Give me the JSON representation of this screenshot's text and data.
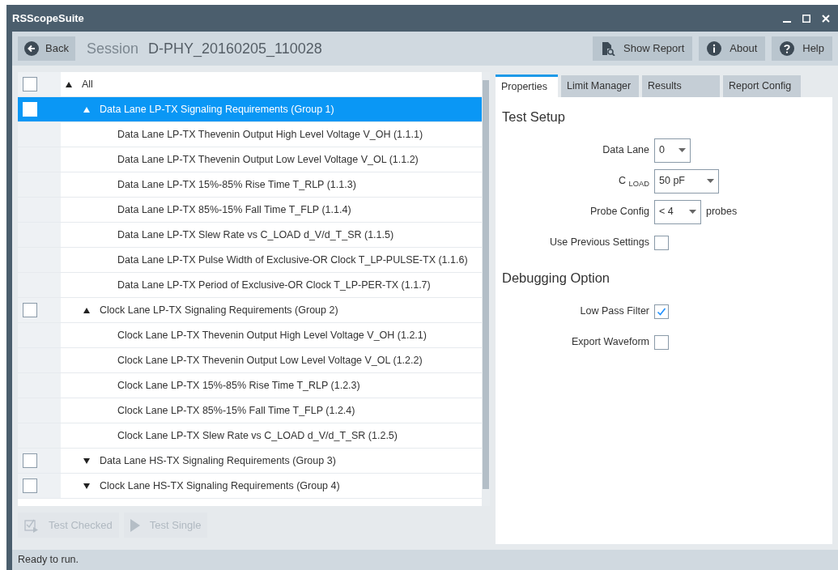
{
  "window": {
    "title": "RSScopeSuite"
  },
  "toolbar": {
    "back": "Back",
    "session_label": "Session",
    "session_name": "D-PHY_20160205_110028",
    "buttons": [
      {
        "kind": "report",
        "label": "Show Report"
      },
      {
        "kind": "about",
        "label": "About"
      },
      {
        "kind": "help",
        "label": "Help"
      }
    ]
  },
  "tree": [
    {
      "label": "All",
      "checked": false,
      "expanded": true,
      "selected": false,
      "children": [
        {
          "label": "Data Lane LP-TX Signaling Requirements (Group 1)",
          "checked": false,
          "expanded": true,
          "selected": true,
          "children": [
            {
              "label": "Data Lane LP-TX Thevenin Output High Level Voltage V_OH (1.1.1)",
              "selected": false
            },
            {
              "label": "Data Lane LP-TX Thevenin Output Low Level Voltage V_OL (1.1.2)",
              "selected": false
            },
            {
              "label": "Data Lane LP-TX 15%-85% Rise Time T_RLP (1.1.3)",
              "selected": false
            },
            {
              "label": "Data Lane LP-TX 85%-15% Fall Time T_FLP (1.1.4)",
              "selected": false
            },
            {
              "label": "Data Lane LP-TX Slew Rate vs C_LOAD d_V/d_T_SR (1.1.5)",
              "selected": false
            },
            {
              "label": "Data Lane LP-TX Pulse Width of Exclusive-OR Clock T_LP-PULSE-TX (1.1.6)",
              "selected": false
            },
            {
              "label": "Data Lane LP-TX Period of Exclusive-OR Clock T_LP-PER-TX (1.1.7)",
              "selected": false
            }
          ]
        },
        {
          "label": "Clock Lane LP-TX Signaling Requirements (Group 2)",
          "checked": false,
          "expanded": true,
          "selected": false,
          "children": [
            {
              "label": "Clock Lane LP-TX Thevenin Output High Level Voltage V_OH (1.2.1)",
              "selected": false
            },
            {
              "label": "Clock Lane LP-TX Thevenin Output Low Level Voltage V_OL (1.2.2)",
              "selected": false
            },
            {
              "label": "Clock Lane LP-TX 15%-85% Rise Time T_RLP (1.2.3)",
              "selected": false
            },
            {
              "label": "Clock Lane LP-TX 85%-15% Fall Time T_FLP (1.2.4)",
              "selected": false
            },
            {
              "label": "Clock Lane LP-TX Slew Rate vs C_LOAD d_V/d_T_SR (1.2.5)",
              "selected": false
            }
          ]
        },
        {
          "label": "Data Lane HS-TX Signaling Requirements (Group 3)",
          "checked": false,
          "expanded": false,
          "selected": false
        },
        {
          "label": "Clock Lane HS-TX Signaling Requirements (Group 4)",
          "checked": false,
          "expanded": false,
          "selected": false
        }
      ]
    }
  ],
  "actions": [
    {
      "kind": "checked",
      "label": "Test Checked",
      "disabled": true
    },
    {
      "kind": "single",
      "label": "Test Single",
      "disabled": true
    }
  ],
  "tabs": [
    {
      "label": "Properties",
      "selected": true
    },
    {
      "label": "Limit Manager",
      "selected": false
    },
    {
      "label": "Results",
      "selected": false
    },
    {
      "label": "Report Config",
      "selected": false
    }
  ],
  "sections": [
    {
      "title": "Test Setup",
      "fields": [
        {
          "kind": "select",
          "label": "Data Lane",
          "value": "0"
        },
        {
          "kind": "select",
          "label": "C $_{LOAD}$",
          "value": "50 pF"
        },
        {
          "kind": "select",
          "label": "Probe Config",
          "value": "< 4",
          "suffix": "probes"
        },
        {
          "kind": "checkbox",
          "label": "Use Previous Settings",
          "checked": false
        }
      ]
    },
    {
      "title": "Debugging Option",
      "fields": [
        {
          "kind": "checkbox",
          "label": "Low Pass Filter",
          "checked": true
        },
        {
          "kind": "checkbox",
          "label": "Export Waveform",
          "checked": false
        }
      ]
    }
  ],
  "status_bar": "Ready to run."
}
